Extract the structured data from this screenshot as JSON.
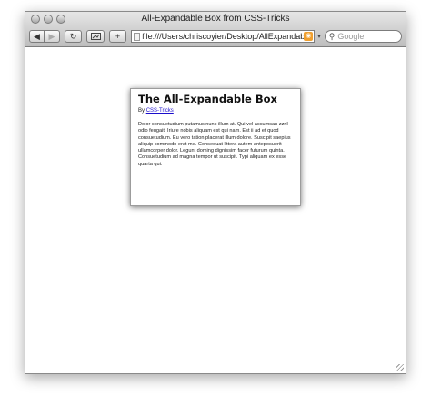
{
  "window": {
    "title": "All-Expandable Box from CSS-Tricks"
  },
  "toolbar": {
    "back_icon": "back-arrow-icon",
    "forward_icon": "forward-arrow-icon",
    "reload_icon": "reload-icon",
    "snapback_icon": "snapback-icon",
    "add_bookmark_label": "+",
    "address_value": "file:///Users/chriscoyier/Desktop/AllExpandab",
    "search_placeholder": "Google"
  },
  "card": {
    "title": "The All-Expandable Box",
    "byline_prefix": "By",
    "byline_link": "CSS-Tricks",
    "body": "Dolor consuetudium putamus nunc illum at. Qui vel accumsan zzril odio feugait. Iriure nobis aliquam est qui nam. Est ii ad et quod consuetudium. Eu vero tation placerat illum dolore. Suscipit saepius aliquip commodo erat me. Consequat littera autem anteposuerit ullamcorper dolor. Legunt doming dignissim facer futurum quinta. Consuetudium ad magna tempor ut suscipit. Typi aliquam ex esse quarta qui."
  }
}
